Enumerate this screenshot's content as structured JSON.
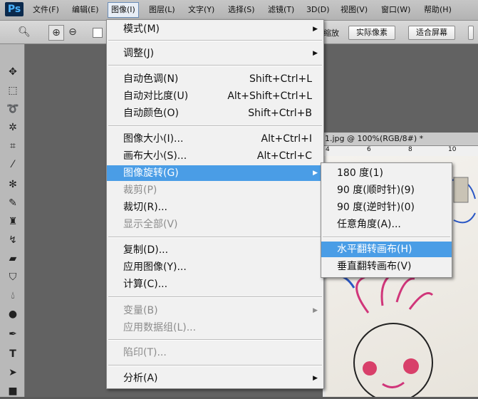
{
  "app": {
    "logo": "Ps"
  },
  "menubar": {
    "items": [
      "文件(F)",
      "编辑(E)",
      "图像(I)",
      "图层(L)",
      "文字(Y)",
      "选择(S)",
      "滤镜(T)",
      "3D(D)",
      "视图(V)",
      "窗口(W)",
      "帮助(H)"
    ],
    "active": "图像(I)"
  },
  "optionsbar": {
    "partial_label": "缩放",
    "actual_pixels": "实际像素",
    "fit_screen": "适合屏幕"
  },
  "document": {
    "tab_title": "1.jpg @ 100%(RGB/8#) *",
    "ruler_ticks": [
      "4",
      "6",
      "8",
      "10"
    ]
  },
  "image_menu": {
    "items": [
      {
        "label": "模式(M)",
        "shortcut": "",
        "submenu": true,
        "enabled": true
      },
      {
        "label": "调整(J)",
        "shortcut": "",
        "submenu": true,
        "enabled": true
      },
      {
        "label": "自动色调(N)",
        "shortcut": "Shift+Ctrl+L",
        "enabled": true
      },
      {
        "label": "自动对比度(U)",
        "shortcut": "Alt+Shift+Ctrl+L",
        "enabled": true
      },
      {
        "label": "自动颜色(O)",
        "shortcut": "Shift+Ctrl+B",
        "enabled": true
      },
      {
        "label": "图像大小(I)...",
        "shortcut": "Alt+Ctrl+I",
        "enabled": true
      },
      {
        "label": "画布大小(S)...",
        "shortcut": "Alt+Ctrl+C",
        "enabled": true
      },
      {
        "label": "图像旋转(G)",
        "shortcut": "",
        "submenu": true,
        "enabled": true,
        "highlighted": true
      },
      {
        "label": "裁剪(P)",
        "shortcut": "",
        "enabled": false
      },
      {
        "label": "裁切(R)...",
        "shortcut": "",
        "enabled": true
      },
      {
        "label": "显示全部(V)",
        "shortcut": "",
        "enabled": false
      },
      {
        "label": "复制(D)...",
        "shortcut": "",
        "enabled": true
      },
      {
        "label": "应用图像(Y)...",
        "shortcut": "",
        "enabled": true
      },
      {
        "label": "计算(C)...",
        "shortcut": "",
        "enabled": true
      },
      {
        "label": "变量(B)",
        "shortcut": "",
        "submenu": true,
        "enabled": false
      },
      {
        "label": "应用数据组(L)...",
        "shortcut": "",
        "enabled": false
      },
      {
        "label": "陷印(T)...",
        "shortcut": "",
        "enabled": false
      },
      {
        "label": "分析(A)",
        "shortcut": "",
        "submenu": true,
        "enabled": true
      }
    ]
  },
  "rotate_submenu": {
    "items": [
      {
        "label": "180 度(1)",
        "highlighted": false
      },
      {
        "label": "90 度(顺时针)(9)",
        "highlighted": false
      },
      {
        "label": "90 度(逆时针)(0)",
        "highlighted": false
      },
      {
        "label": "任意角度(A)...",
        "highlighted": false
      },
      {
        "label": "水平翻转画布(H)",
        "highlighted": true
      },
      {
        "label": "垂直翻转画布(V)",
        "highlighted": false
      }
    ]
  },
  "colors": {
    "menu_highlight": "#4a9de6",
    "menu_bg": "#f1f1f1",
    "disabled_text": "#8c8c8c",
    "drawing_hair": "#d0367a",
    "drawing_cheeks": "#d8406a"
  }
}
